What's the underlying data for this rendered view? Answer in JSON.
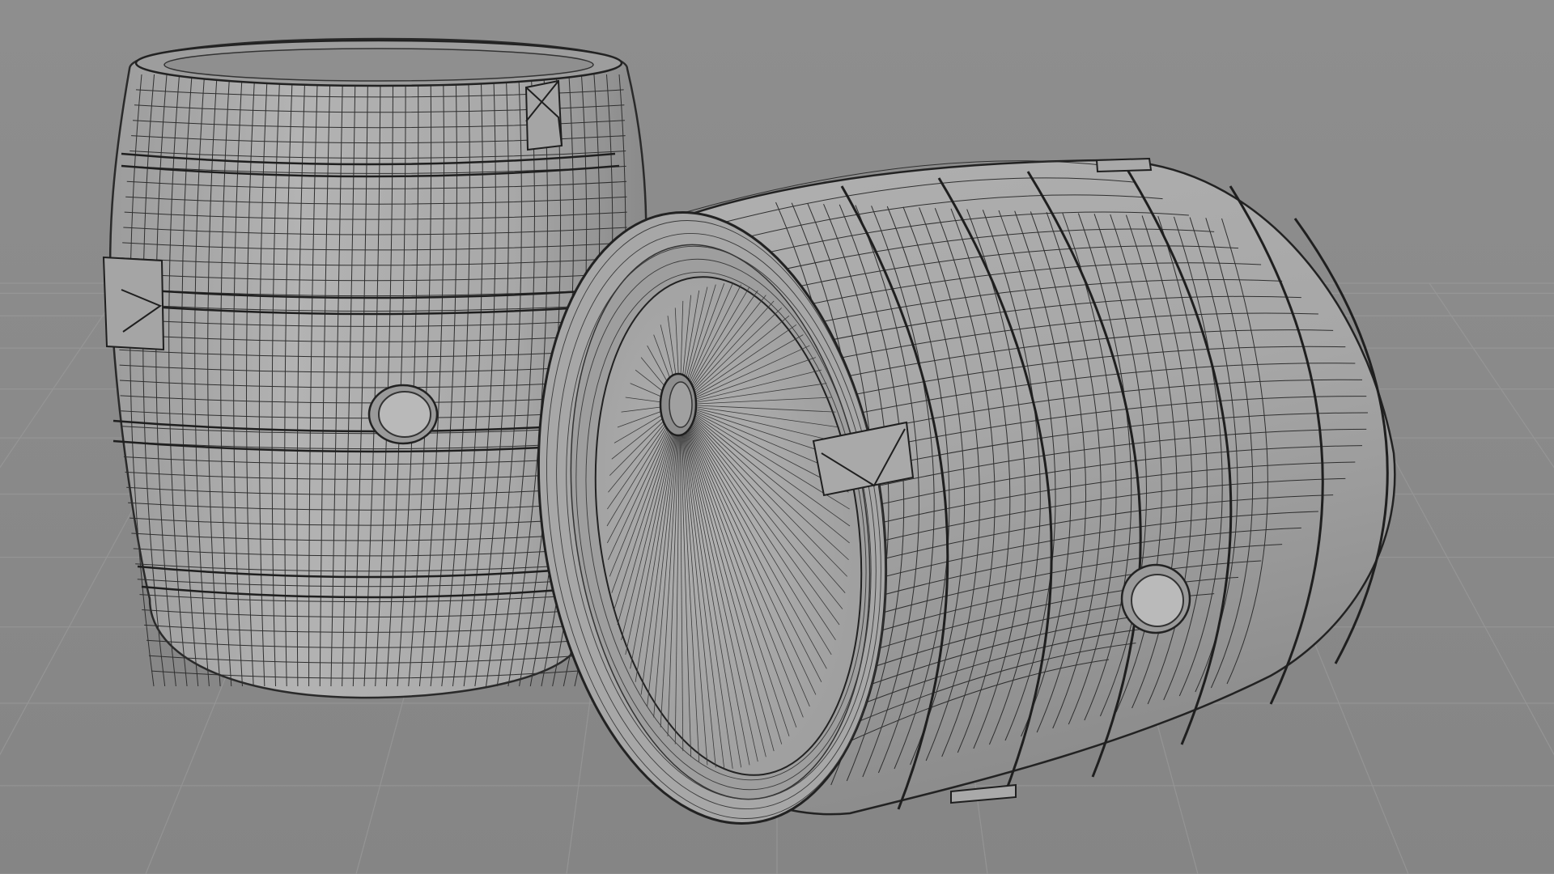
{
  "viewport": {
    "shading": "solid-wireframe",
    "background_color": "#8a8a8a",
    "grid_color": "#9a9a9a",
    "mesh_base_color": "#a9a9a9",
    "mesh_wire_color": "#2a2a2a",
    "objects": [
      {
        "name": "barrel-upright",
        "orientation": "upright"
      },
      {
        "name": "barrel-lying",
        "orientation": "on-side"
      }
    ],
    "icons": [
      "grid-floor-icon"
    ]
  }
}
